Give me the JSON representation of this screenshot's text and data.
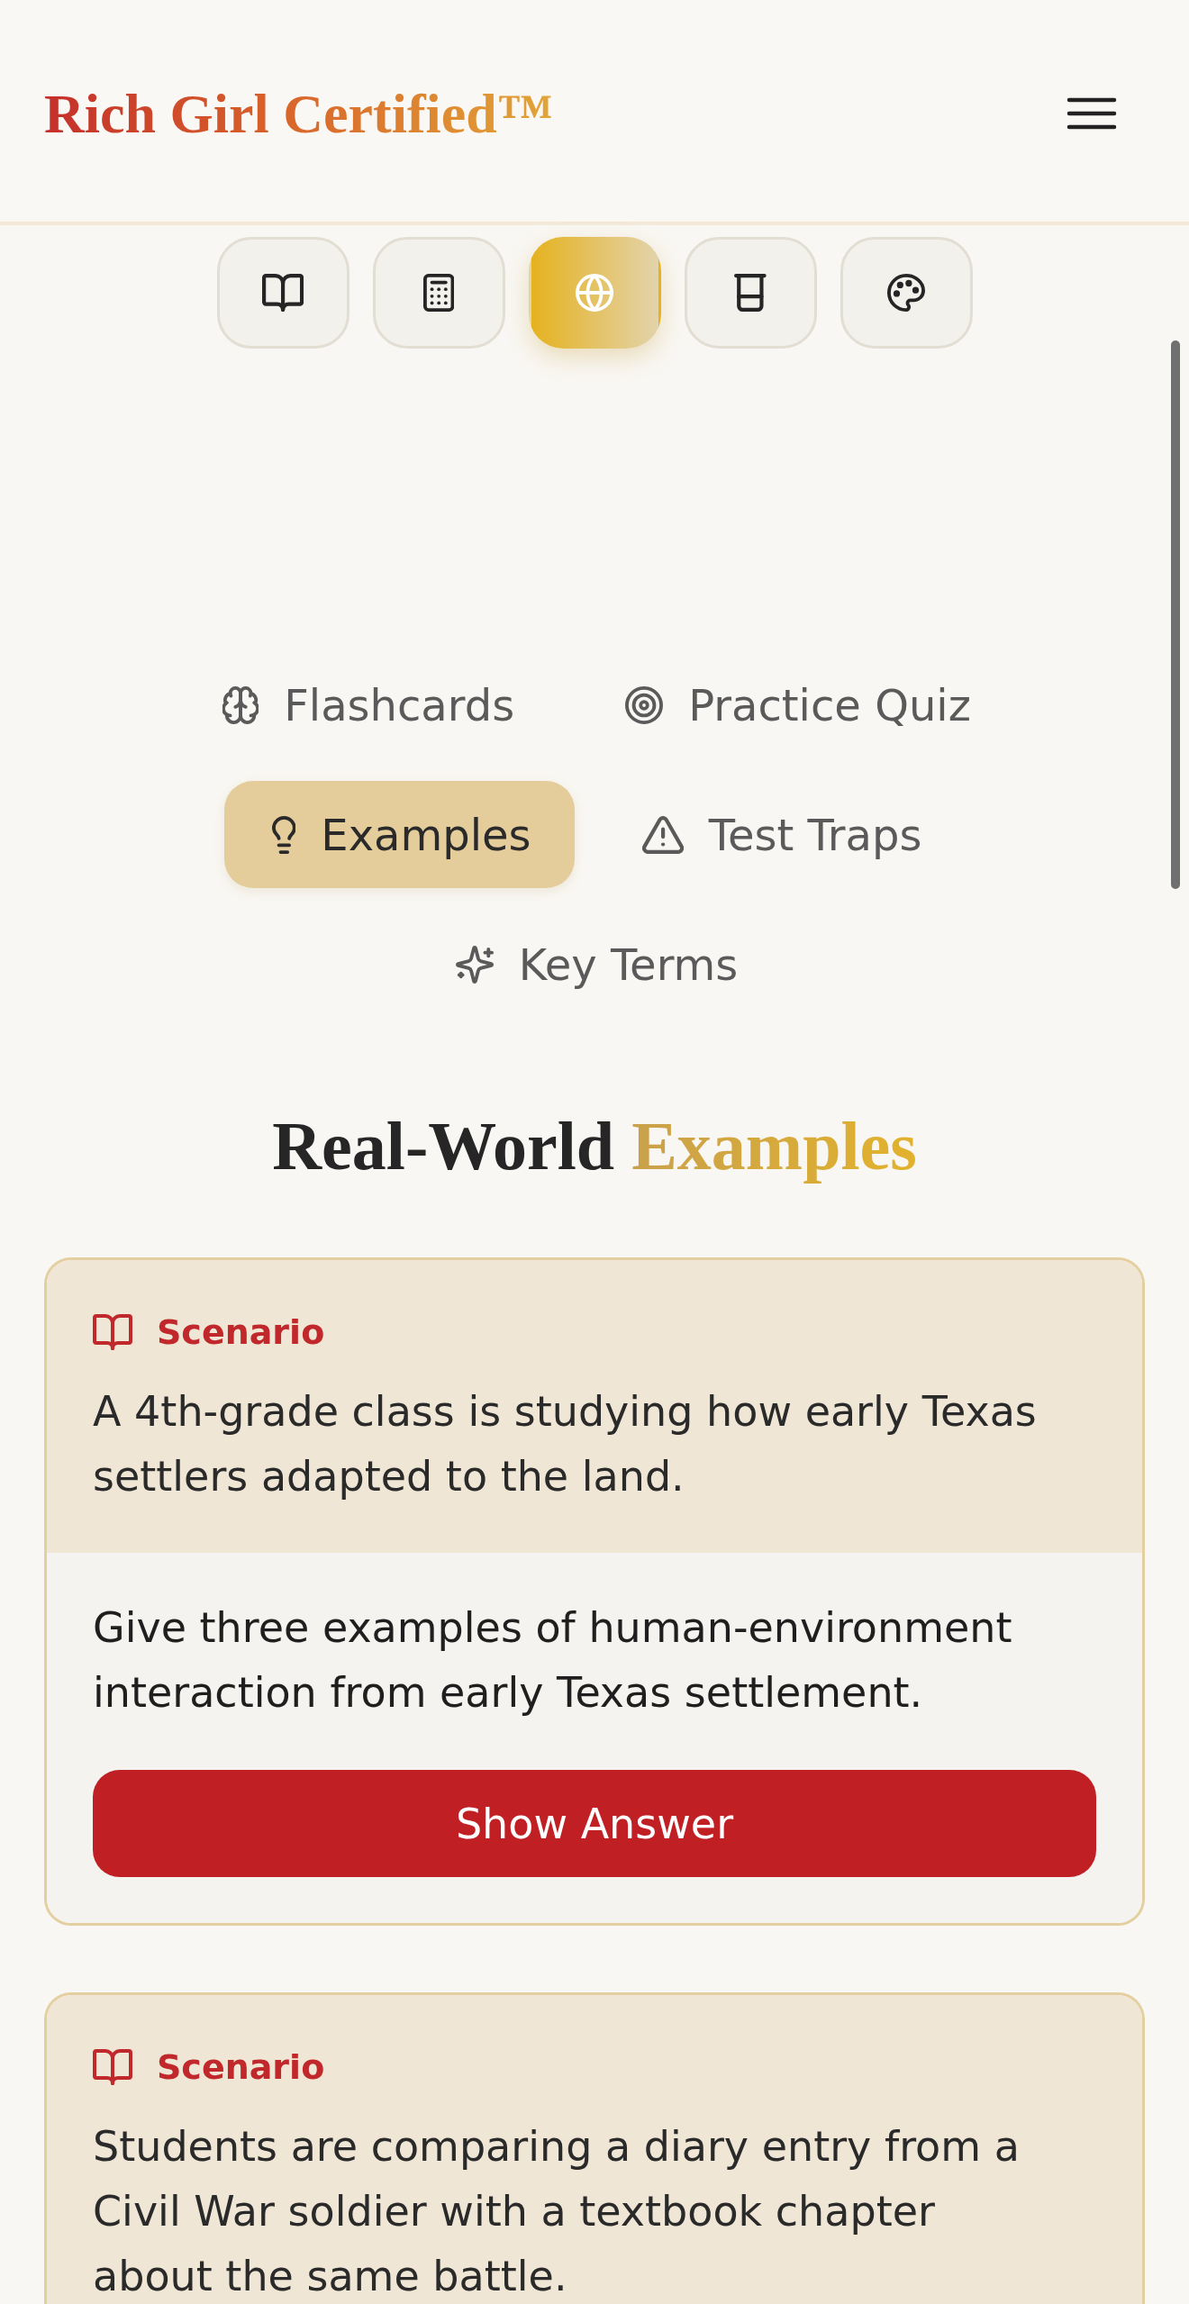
{
  "header": {
    "logo": "Rich Girl Certified™"
  },
  "subjects": [
    {
      "selected": false
    },
    {
      "selected": false
    },
    {
      "selected": true
    },
    {
      "selected": false
    },
    {
      "selected": false
    }
  ],
  "tabs": [
    {
      "label": "Flashcards",
      "selected": false
    },
    {
      "label": "Practice Quiz",
      "selected": false
    },
    {
      "label": "Examples",
      "selected": true
    },
    {
      "label": "Test Traps",
      "selected": false
    },
    {
      "label": "Key Terms",
      "selected": false
    }
  ],
  "section": {
    "heading": "Real-World",
    "heading_accent": "Examples"
  },
  "examples": [
    {
      "label": "Scenario",
      "scenario": "A 4th-grade class is studying how early Texas settlers adapted to the land.",
      "question": "Give three examples of human-environment interaction from early Texas settlement.",
      "button": "Show Answer"
    },
    {
      "label": "Scenario",
      "scenario": "Students are comparing a diary entry from a Civil War soldier with a textbook chapter about the same battle."
    }
  ]
}
